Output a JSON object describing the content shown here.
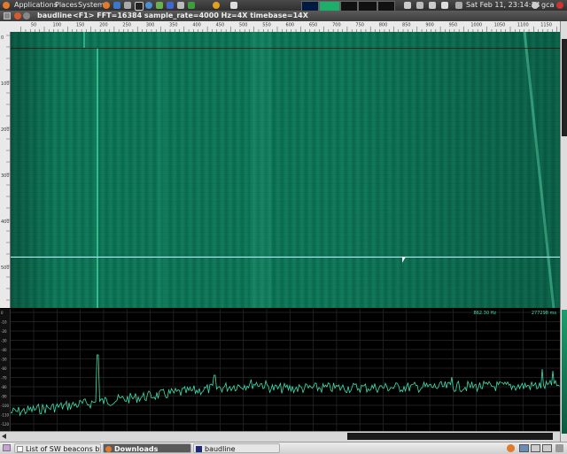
{
  "top_panel": {
    "menus": [
      "Applications",
      "Places",
      "System"
    ],
    "clock": "Sat Feb 11, 23:14:34",
    "user": "gca"
  },
  "window": {
    "title": "baudline",
    "status": "<F1> FFT=16384 sample_rate=4000 Hz=4X timebase=14X"
  },
  "frequency_ruler": {
    "tick_labels": [
      "50",
      "100",
      "150",
      "200",
      "250",
      "300",
      "350",
      "400",
      "450",
      "500",
      "550",
      "600",
      "650",
      "700",
      "750",
      "800",
      "850",
      "900",
      "950",
      "1000",
      "1050",
      "1100",
      "1150"
    ]
  },
  "time_ruler": {
    "tick_labels": [
      "0",
      "100",
      "200",
      "300",
      "400",
      "500"
    ]
  },
  "spectrum_readout": {
    "frequency": "862.30 Hz",
    "sample": "277298 ms"
  },
  "spectrum_db_labels": [
    "0",
    "-10",
    "-20",
    "-30",
    "-40",
    "-50",
    "-60",
    "-70",
    "-80",
    "-90",
    "-100",
    "-110",
    "-120"
  ],
  "taskbar": {
    "items": [
      {
        "label": "List of SW beacons by ..."
      },
      {
        "label": "Downloads"
      },
      {
        "label": "baudline"
      }
    ]
  },
  "colors": {
    "waterfall": "#0c7a5a",
    "trace": "#3fe0b0",
    "grid": "#2a2a2a"
  }
}
